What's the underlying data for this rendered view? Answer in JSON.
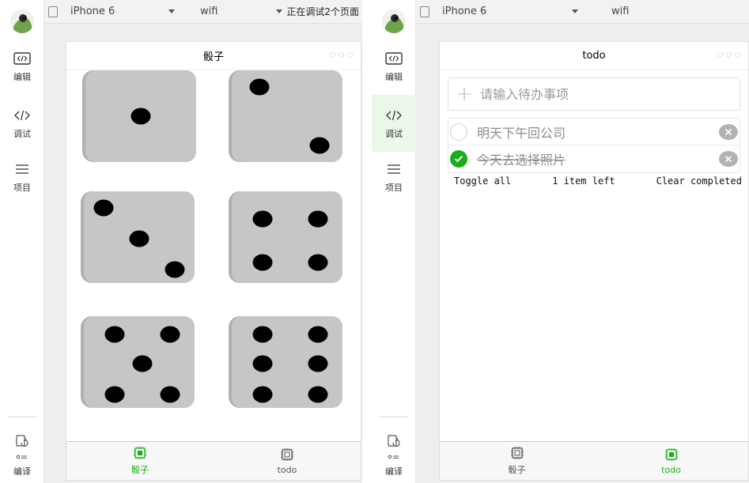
{
  "colors": {
    "accent": "#45c03a",
    "tab_active": "#1aad19",
    "die_face": "#c6c6c6",
    "die_shadow": "#b0b0b0",
    "pip": "#000000"
  },
  "left": {
    "sidebar": {
      "items": [
        {
          "label": "编辑",
          "icon": "code-box-icon",
          "state": "active"
        },
        {
          "label": "调试",
          "icon": "code-brackets-icon",
          "state": "normal"
        },
        {
          "label": "项目",
          "icon": "list-icon",
          "state": "normal"
        }
      ],
      "compile_label": "编译"
    },
    "toolbar": {
      "device": "iPhone 6",
      "network": "wifi",
      "status": "正在调试2个页面"
    },
    "page": {
      "title": "骰子",
      "dice": [
        {
          "value": 1
        },
        {
          "value": 2
        },
        {
          "value": 3
        },
        {
          "value": 4
        },
        {
          "value": 5
        },
        {
          "value": 6
        }
      ]
    },
    "tabs": [
      {
        "label": "骰子",
        "icon": "chip-icon",
        "active": true
      },
      {
        "label": "todo",
        "icon": "chip-icon",
        "active": false
      }
    ]
  },
  "right": {
    "sidebar": {
      "items": [
        {
          "label": "编辑",
          "icon": "code-box-icon",
          "state": "active"
        },
        {
          "label": "调试",
          "icon": "code-brackets-icon",
          "state": "soft"
        },
        {
          "label": "项目",
          "icon": "list-icon",
          "state": "normal"
        }
      ],
      "compile_label": "编译"
    },
    "toolbar": {
      "device": "iPhone 6",
      "network": "wifi"
    },
    "page": {
      "title": "todo",
      "input_placeholder": "请输入待办事项",
      "todos": [
        {
          "text": "明天下午回公司",
          "completed": false
        },
        {
          "text": "今天去选择照片",
          "completed": true
        }
      ],
      "footer": {
        "toggle_all": "Toggle all",
        "left_count": "1 item left",
        "clear_completed": "Clear completed"
      }
    },
    "tabs": [
      {
        "label": "骰子",
        "icon": "chip-icon",
        "active": false
      },
      {
        "label": "todo",
        "icon": "chip-icon",
        "active": true
      }
    ]
  }
}
